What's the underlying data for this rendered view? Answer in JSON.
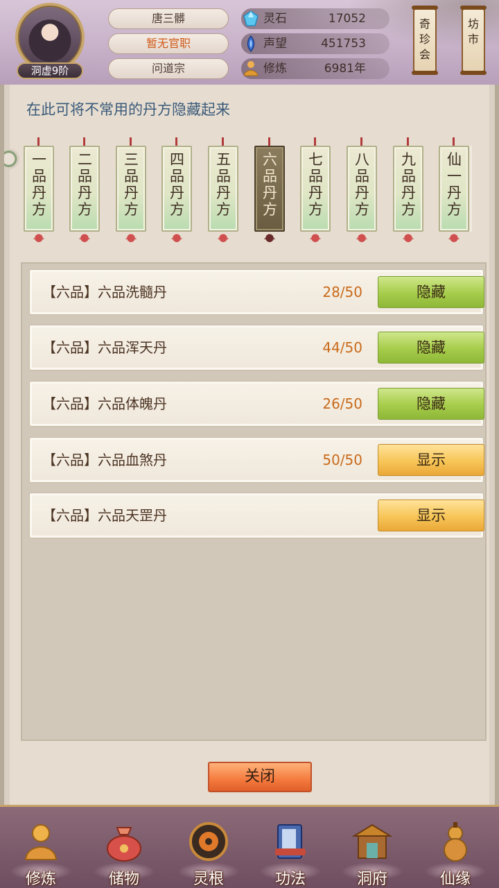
{
  "player": {
    "name": "唐三髒",
    "official_title": "暂无官职",
    "sect": "问道宗",
    "realm": "洞虚9阶"
  },
  "stats": [
    {
      "icon": "spirit-stone-icon",
      "label": "灵石",
      "value": "17052"
    },
    {
      "icon": "reputation-icon",
      "label": "声望",
      "value": "451753"
    },
    {
      "icon": "cultivation-icon",
      "label": "修炼",
      "value": "6981年"
    }
  ],
  "top_buttons": {
    "qizhen": "奇珍会",
    "fangshi": "坊市"
  },
  "panel": {
    "hint": "在此可将不常用的丹方隐藏起来",
    "tabs": [
      {
        "label": "一品丹方",
        "active": false
      },
      {
        "label": "二品丹方",
        "active": false
      },
      {
        "label": "三品丹方",
        "active": false
      },
      {
        "label": "四品丹方",
        "active": false
      },
      {
        "label": "五品丹方",
        "active": false
      },
      {
        "label": "六品丹方",
        "active": true
      },
      {
        "label": "七品丹方",
        "active": false
      },
      {
        "label": "八品丹方",
        "active": false
      },
      {
        "label": "九品丹方",
        "active": false
      },
      {
        "label": "仙一丹方",
        "active": false
      }
    ],
    "recipes": [
      {
        "name": "【六品】六品洗髓丹",
        "count": "28/50",
        "action": "隐藏",
        "state": "green"
      },
      {
        "name": "【六品】六品浑天丹",
        "count": "44/50",
        "action": "隐藏",
        "state": "green"
      },
      {
        "name": "【六品】六品体魄丹",
        "count": "26/50",
        "action": "隐藏",
        "state": "green"
      },
      {
        "name": "【六品】六品血煞丹",
        "count": "50/50",
        "action": "显示",
        "state": "orange"
      },
      {
        "name": "【六品】六品天罡丹",
        "count": "",
        "action": "显示",
        "state": "orange"
      }
    ],
    "close_label": "关闭"
  },
  "bottom_nav": [
    {
      "label": "修炼",
      "icon": "meditating-monk-icon",
      "color": "#e0a040"
    },
    {
      "label": "储物",
      "icon": "storage-bag-icon",
      "color": "#d0504a"
    },
    {
      "label": "灵根",
      "icon": "spirit-root-icon",
      "color": "#c86a2a"
    },
    {
      "label": "功法",
      "icon": "technique-book-icon",
      "color": "#4a6ab0"
    },
    {
      "label": "洞府",
      "icon": "cave-dwelling-icon",
      "color": "#c0884a"
    },
    {
      "label": "仙缘",
      "icon": "gourd-icon",
      "color": "#d89a40"
    }
  ]
}
